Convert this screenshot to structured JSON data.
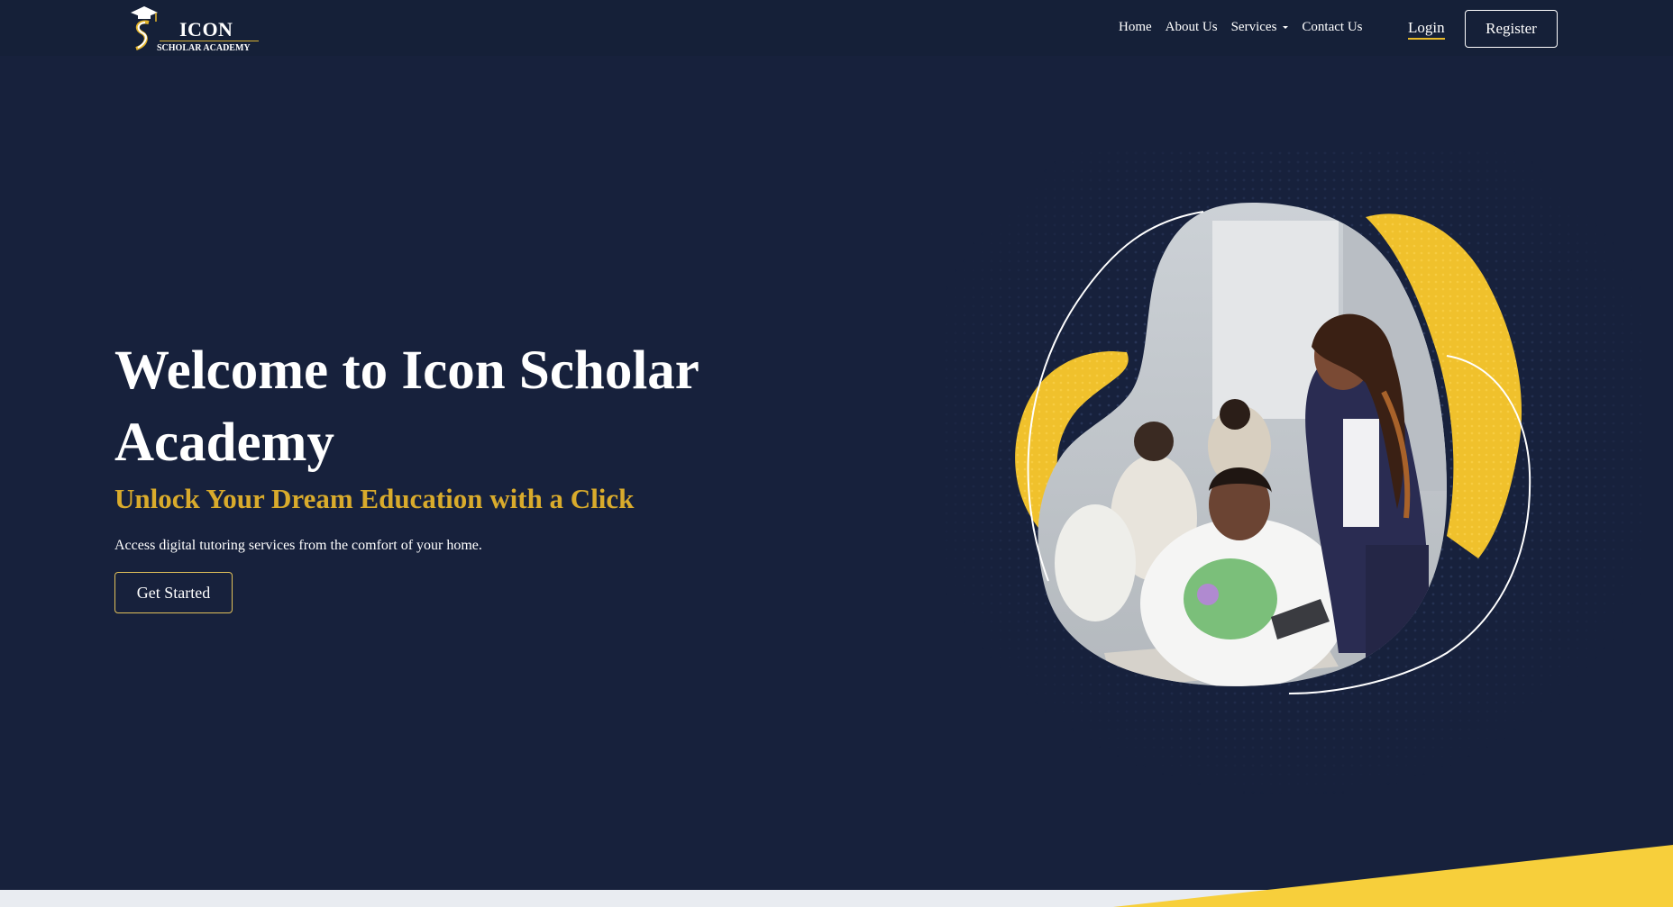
{
  "brand": {
    "name": "ICON",
    "tagline": "SCHOLAR ACADEMY"
  },
  "nav": {
    "links": [
      {
        "label": "Home"
      },
      {
        "label": "About Us"
      },
      {
        "label": "Services",
        "has_dropdown": true
      },
      {
        "label": "Contact Us"
      }
    ],
    "login_label": "Login",
    "register_label": "Register"
  },
  "hero": {
    "title": "Welcome to Icon Scholar Academy",
    "subtitle": "Unlock Your Dream Education with a Click",
    "text": "Access digital tutoring services from the comfort of your home.",
    "cta_label": "Get Started"
  },
  "colors": {
    "background": "#17213c",
    "navbar": "#152038",
    "accent_gold": "#d9ab2c",
    "blob_yellow": "#f0c12c",
    "white": "#ffffff"
  },
  "icons": {
    "dropdown": "chevron-down-icon",
    "logo": "graduation-cap-icon"
  }
}
